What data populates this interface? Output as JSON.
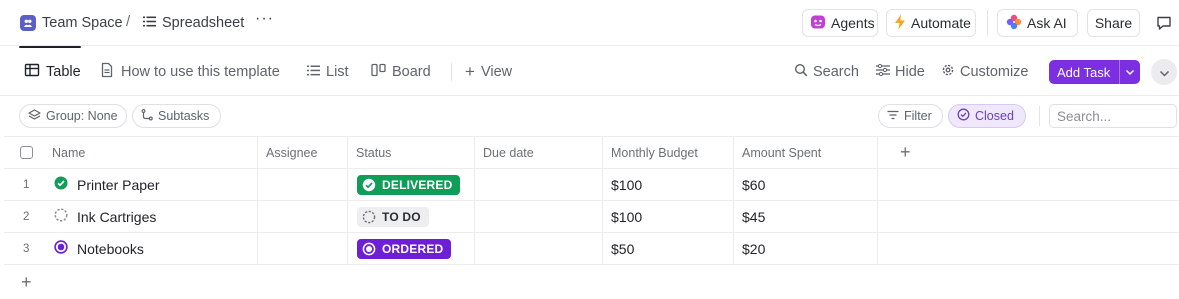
{
  "breadcrumb": {
    "space": "Team Space",
    "separator": "/",
    "page": "Spreadsheet",
    "more": "···"
  },
  "topbar": {
    "agents": "Agents",
    "automate": "Automate",
    "ask_ai": "Ask AI",
    "share": "Share"
  },
  "views": {
    "table": "Table",
    "how_to": "How to use this template",
    "list": "List",
    "board": "Board",
    "add_view": "View"
  },
  "actions": {
    "search": "Search",
    "hide": "Hide",
    "customize": "Customize",
    "add_task": "Add Task"
  },
  "filters": {
    "group": "Group: None",
    "subtasks": "Subtasks",
    "filter": "Filter",
    "closed": "Closed",
    "search_placeholder": "Search..."
  },
  "table": {
    "columns": [
      "Name",
      "Assignee",
      "Status",
      "Due date",
      "Monthly Budget",
      "Amount Spent"
    ],
    "rows": [
      {
        "num": "1",
        "name": "Printer Paper",
        "status": "DELIVERED",
        "budget": "$100",
        "spent": "$60"
      },
      {
        "num": "2",
        "name": "Ink Cartriges",
        "status": "TO DO",
        "budget": "$100",
        "spent": "$45"
      },
      {
        "num": "3",
        "name": "Notebooks",
        "status": "ORDERED",
        "budget": "$50",
        "spent": "$20"
      }
    ]
  },
  "colors": {
    "accent": "#7b2fe0",
    "delivered": "#0f9d58",
    "ordered": "#6d1fd6",
    "todo_bg": "#eeeef0"
  }
}
